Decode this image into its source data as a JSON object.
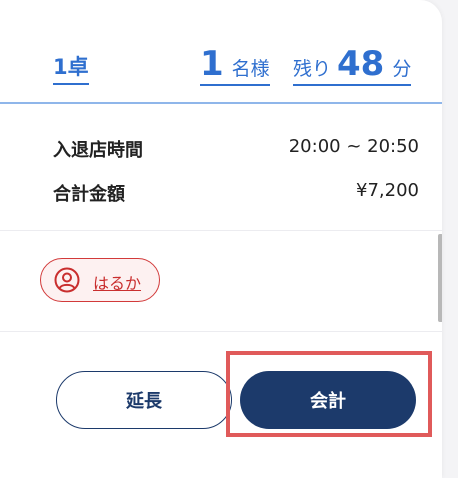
{
  "header": {
    "table_label": "1卓",
    "guests_count": "1",
    "guests_unit": "名様",
    "remaining_prefix": "残り",
    "remaining_minutes": "48",
    "remaining_unit": "分"
  },
  "info": {
    "visit_time_label": "入退店時間",
    "visit_time_value": "20:00 ~ 20:50",
    "total_label": "合計金額",
    "total_value": "¥7,200"
  },
  "cast": {
    "name": "はるか",
    "icon": "user-circle-icon"
  },
  "actions": {
    "extend_label": "延長",
    "checkout_label": "会計"
  },
  "colors": {
    "accent_blue": "#2f6fcf",
    "navy": "#1c3a6b",
    "chip_red": "#d23a3a",
    "highlight_red": "#e05a5a"
  }
}
